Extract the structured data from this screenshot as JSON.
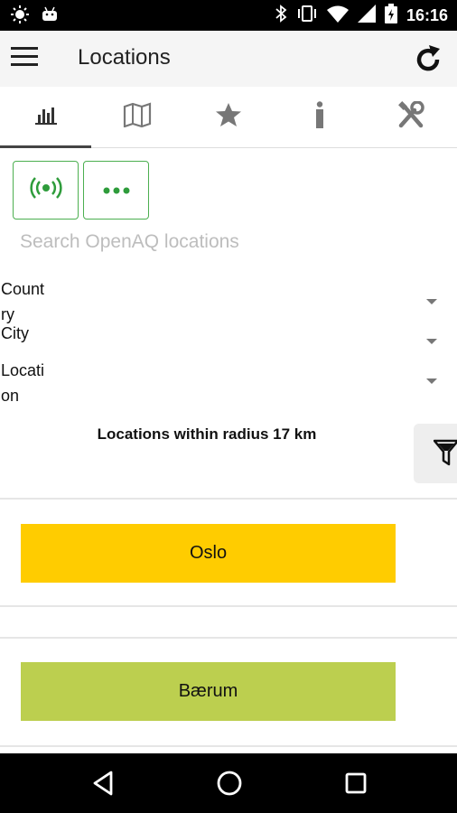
{
  "status_bar": {
    "time": "16:16",
    "left_icons": [
      "brightness-icon",
      "android-icon"
    ],
    "right_icons": [
      "bluetooth-icon",
      "vibrate-icon",
      "wifi-icon",
      "signal-icon",
      "battery-icon"
    ]
  },
  "toolbar": {
    "title": "Locations",
    "menu_icon": "hamburger-menu-icon",
    "refresh_icon": "refresh-icon"
  },
  "tabs": [
    {
      "icon": "bar-chart-icon",
      "active": true
    },
    {
      "icon": "map-icon",
      "active": false
    },
    {
      "icon": "star-icon",
      "active": false
    },
    {
      "icon": "info-icon",
      "active": false
    },
    {
      "icon": "tools-icon",
      "active": false
    }
  ],
  "mode_buttons": {
    "locate_icon": "gps-signal-icon",
    "more_icon": "more-dots-icon",
    "accent_color": "#4caf50"
  },
  "search": {
    "placeholder": "Search OpenAQ locations",
    "value": ""
  },
  "filters": {
    "country_label": "Country",
    "city_label": "City",
    "location_label": "Location"
  },
  "radius_label": "Locations within radius 17 km",
  "locations": [
    {
      "name": "Oslo",
      "color": "#ffcc00"
    },
    {
      "name": "Bærum",
      "color": "#bccf4f"
    }
  ]
}
